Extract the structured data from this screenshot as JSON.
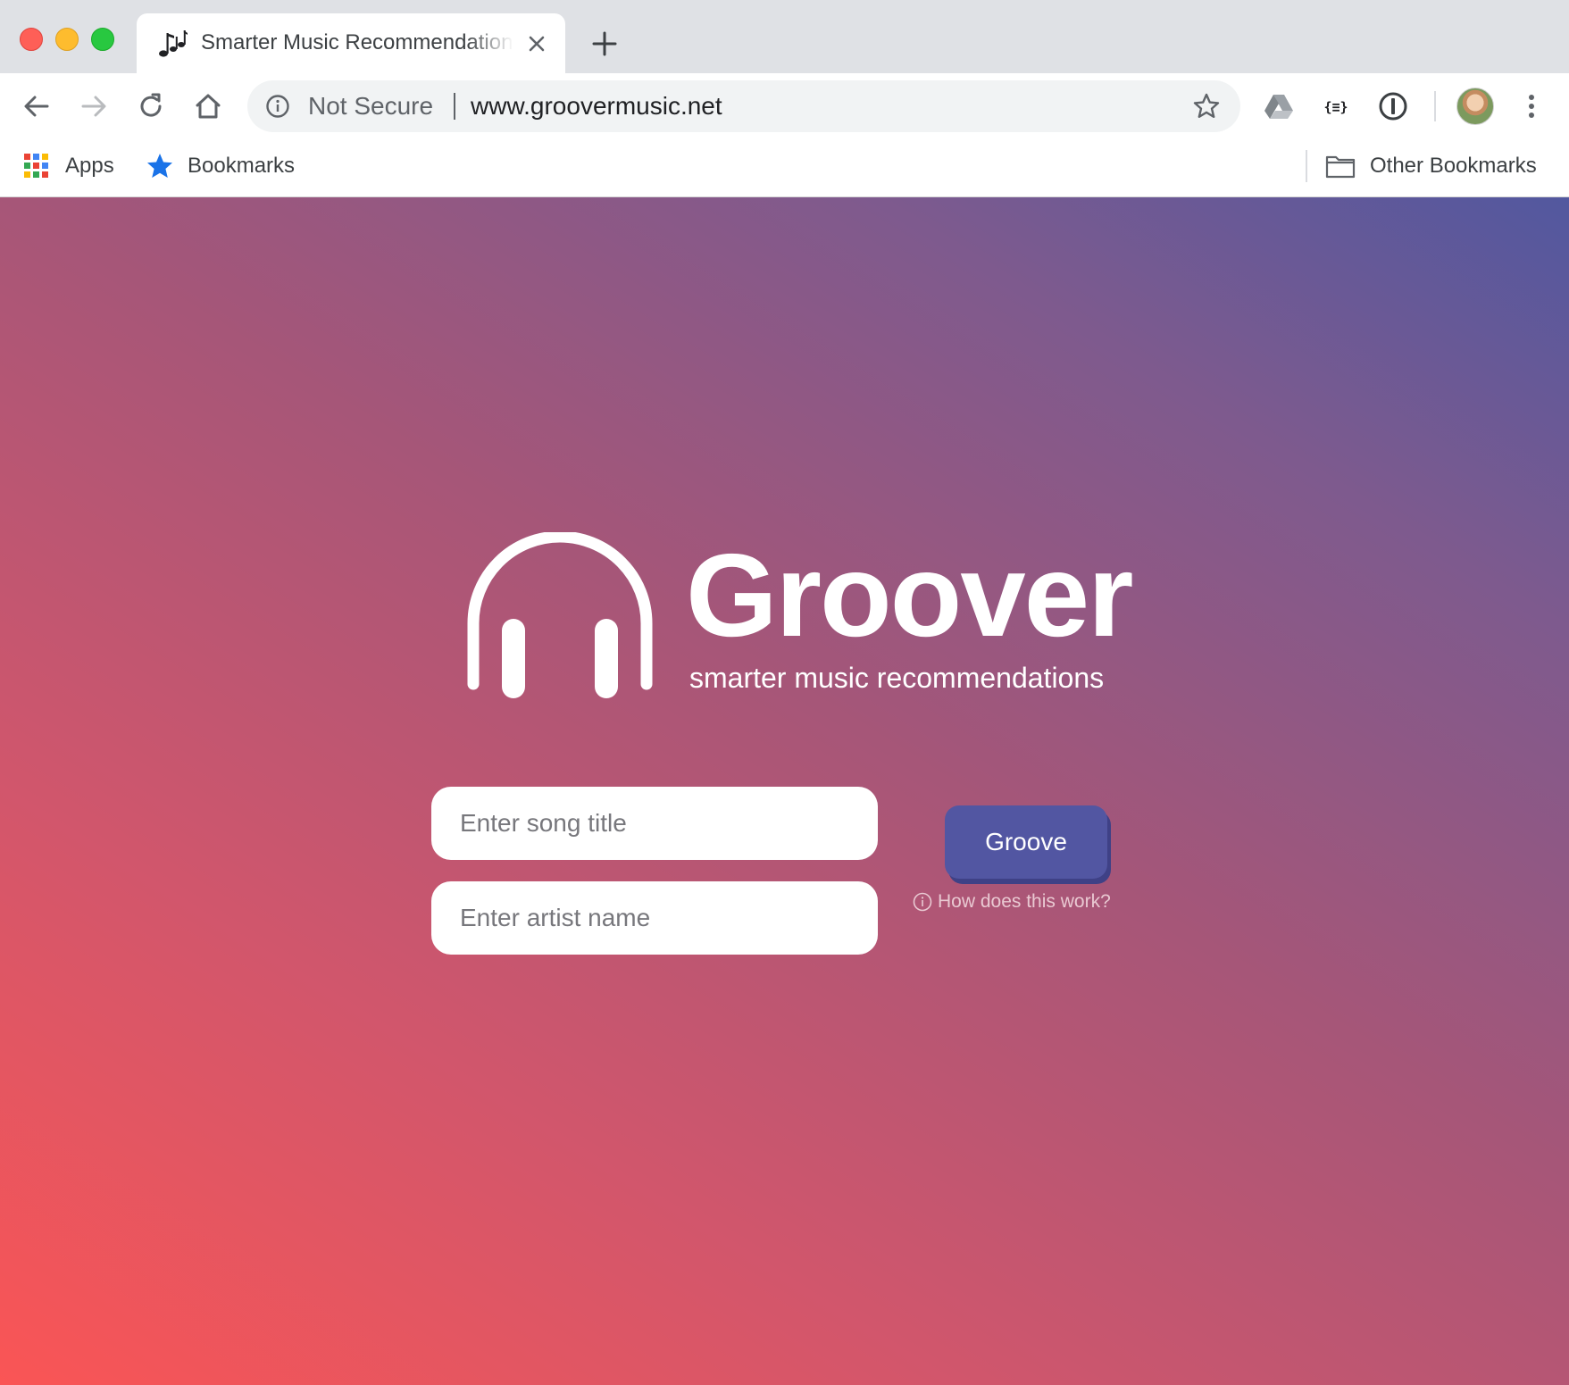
{
  "window": {
    "tab": {
      "title": "Smarter Music Recommendations",
      "favicon": "music-notes-icon"
    }
  },
  "toolbar": {
    "security_label": "Not Secure",
    "url": "www.groovermusic.net",
    "icons": [
      "back-icon",
      "forward-icon",
      "reload-icon",
      "home-icon",
      "info-icon",
      "star-icon",
      "google-drive-icon",
      "json-formatter-icon",
      "password-manager-icon",
      "profile-avatar",
      "menu-icon"
    ]
  },
  "bookmarks_bar": {
    "apps_label": "Apps",
    "bookmarks_label": "Bookmarks",
    "other_label": "Other Bookmarks"
  },
  "page": {
    "logo_icon": "headphones-icon",
    "brand_name": "Groover",
    "tagline": "smarter music recommendations",
    "song_placeholder": "Enter song title",
    "artist_placeholder": "Enter artist name",
    "song_value": "",
    "artist_value": "",
    "button_label": "Groove",
    "help_label": "How does this work?",
    "colors": {
      "gradient_start": "#fa5555",
      "gradient_end": "#52589f",
      "button": "#5256a2",
      "help_text": "#e9c9d2"
    }
  }
}
